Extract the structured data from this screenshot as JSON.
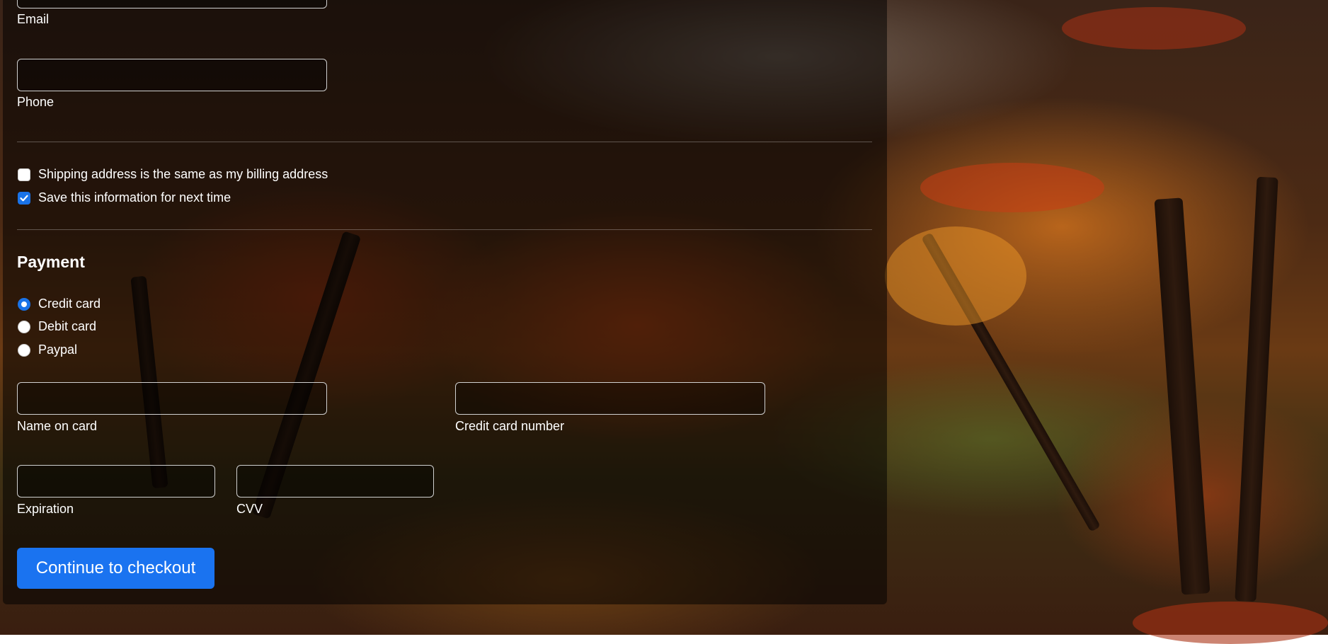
{
  "form": {
    "contact": {
      "email_label": "Email",
      "email_value": "",
      "phone_label": "Phone",
      "phone_value": ""
    },
    "options": {
      "shipping_same_label": "Shipping address is the same as my billing address",
      "shipping_same_checked": false,
      "save_info_label": "Save this information for next time",
      "save_info_checked": true
    },
    "payment": {
      "title": "Payment",
      "methods": [
        {
          "label": "Credit card",
          "selected": true
        },
        {
          "label": "Debit card",
          "selected": false
        },
        {
          "label": "Paypal",
          "selected": false
        }
      ],
      "name_on_card_label": "Name on card",
      "card_number_label": "Credit card number",
      "expiration_label": "Expiration",
      "cvv_label": "CVV"
    },
    "submit_label": "Continue to checkout"
  },
  "colors": {
    "accent": "#1a73f0",
    "panel_overlay": "rgba(0,0,0,0.52)"
  },
  "icons": {
    "checkbox_check": "check-icon"
  }
}
